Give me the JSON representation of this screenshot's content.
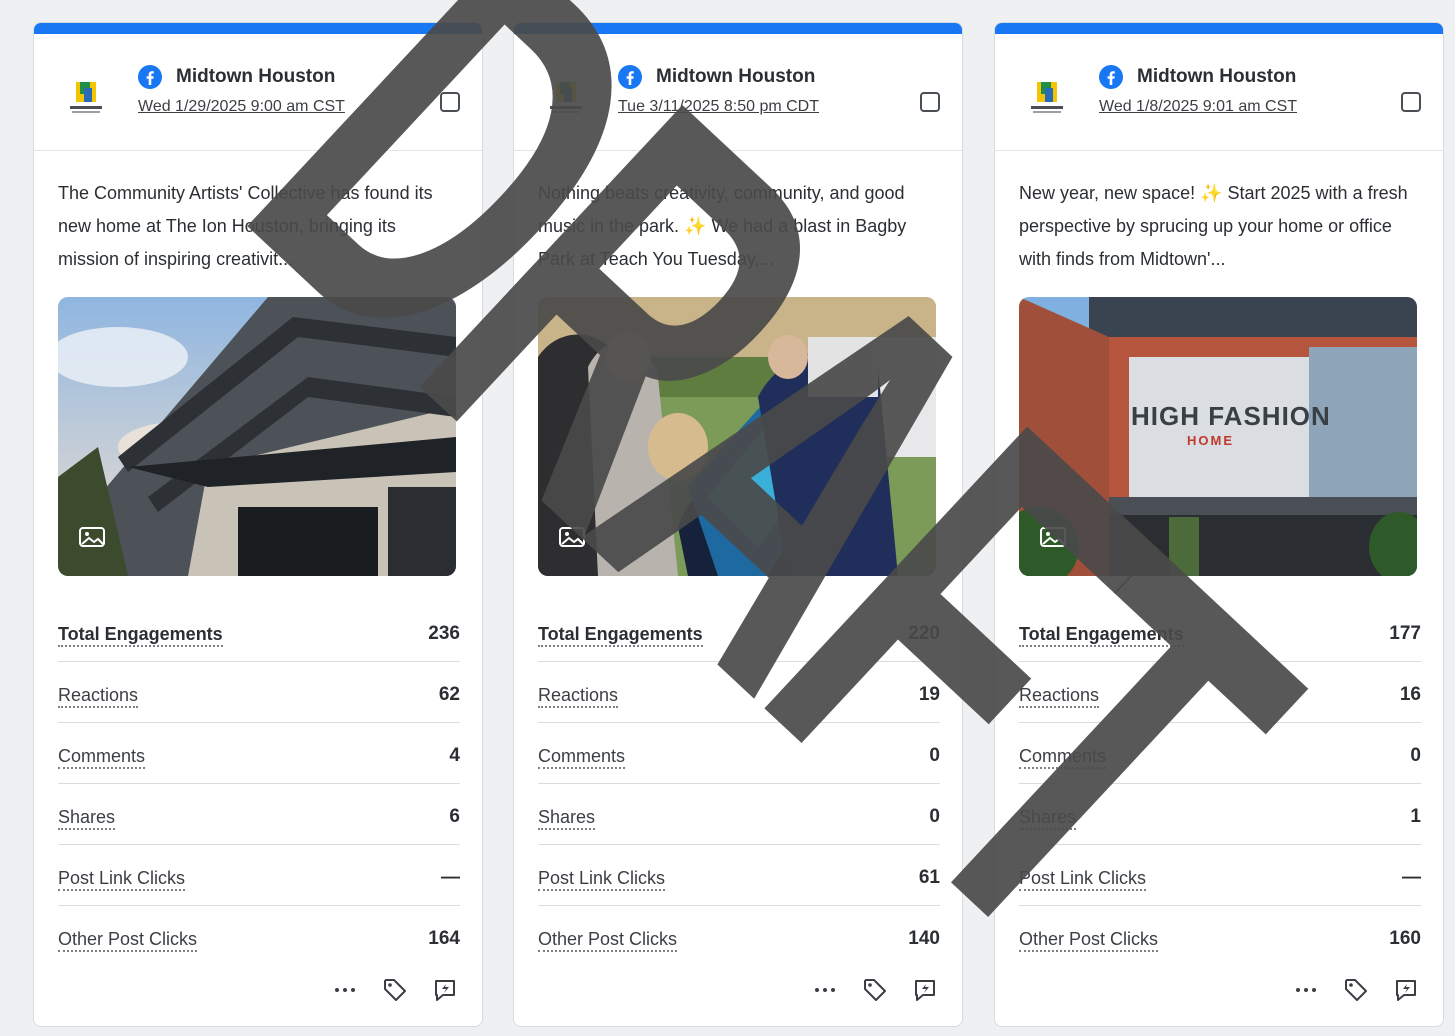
{
  "colors": {
    "accent": "#1877f2",
    "watermark": "#4a4a4a"
  },
  "watermark_text": "DRAFT",
  "cards": [
    {
      "account": "Midtown Houston",
      "platform_icon": "facebook-icon",
      "logo_icon": "midtown-logo-icon",
      "date": "Wed 1/29/2025 9:00 am CST",
      "text": "The Community Artists' Collective has found its new home at The Ion Houston, bringing its mission of inspiring creativit...",
      "image_icon": "image-icon",
      "metrics": [
        {
          "label": "Total Engagements",
          "value": "236"
        },
        {
          "label": "Reactions",
          "value": "62"
        },
        {
          "label": "Comments",
          "value": "4"
        },
        {
          "label": "Shares",
          "value": "6"
        },
        {
          "label": "Post Link Clicks",
          "value": "—"
        },
        {
          "label": "Other Post Clicks",
          "value": "164"
        }
      ],
      "actions": [
        "more-icon",
        "tag-icon",
        "quick-reply-icon"
      ]
    },
    {
      "account": "Midtown Houston",
      "platform_icon": "facebook-icon",
      "logo_icon": "midtown-logo-icon",
      "date": "Tue 3/11/2025 8:50 pm CDT",
      "text": "Nothing beats creativity, community, and good music in the park. ✨ We had a blast in Bagby Park at Teach You Tuesday,...",
      "image_icon": "image-icon",
      "metrics": [
        {
          "label": "Total Engagements",
          "value": "220"
        },
        {
          "label": "Reactions",
          "value": "19"
        },
        {
          "label": "Comments",
          "value": "0"
        },
        {
          "label": "Shares",
          "value": "0"
        },
        {
          "label": "Post Link Clicks",
          "value": "61"
        },
        {
          "label": "Other Post Clicks",
          "value": "140"
        }
      ],
      "actions": [
        "more-icon",
        "tag-icon",
        "quick-reply-icon"
      ]
    },
    {
      "account": "Midtown Houston",
      "platform_icon": "facebook-icon",
      "logo_icon": "midtown-logo-icon",
      "date": "Wed 1/8/2025 9:01 am CST",
      "text": "New year, new space! ✨ Start 2025 with a fresh perspective by sprucing up your home or office with finds from Midtown'...",
      "image_icon": "image-icon",
      "image_sign": "HIGH FASHION",
      "image_sign_sub": "HOME",
      "metrics": [
        {
          "label": "Total Engagements",
          "value": "177"
        },
        {
          "label": "Reactions",
          "value": "16"
        },
        {
          "label": "Comments",
          "value": "0"
        },
        {
          "label": "Shares",
          "value": "1"
        },
        {
          "label": "Post Link Clicks",
          "value": "—"
        },
        {
          "label": "Other Post Clicks",
          "value": "160"
        }
      ],
      "actions": [
        "more-icon",
        "tag-icon",
        "quick-reply-icon"
      ]
    }
  ]
}
